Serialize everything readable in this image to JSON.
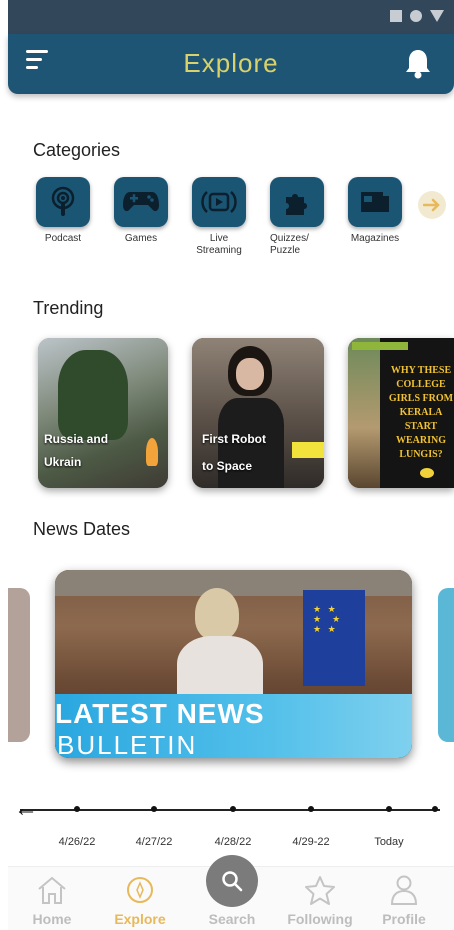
{
  "header": {
    "title": "Explore"
  },
  "colors": {
    "appbar": "#1e5575",
    "title": "#d9d26a",
    "accent": "#e8b95a",
    "category_box": "#1a5574"
  },
  "categories": {
    "title": "Categories",
    "items": [
      {
        "label": "Podcast",
        "icon": "podcast-icon"
      },
      {
        "label": "Games",
        "icon": "gamepad-icon"
      },
      {
        "label": "Live Streaming",
        "icon": "live-stream-icon"
      },
      {
        "label": "Quizzes/ Puzzle",
        "icon": "puzzle-icon"
      },
      {
        "label": "Magazines",
        "icon": "magazine-icon"
      }
    ]
  },
  "trending": {
    "title": "Trending",
    "items": [
      {
        "caption_line1": "Russia and",
        "caption_line2": "Ukrain"
      },
      {
        "caption_line1": "First Robot",
        "caption_line2": "to Space"
      },
      {
        "caption_line1": "WHY THESE COLLEGE GIRLS FROM KERALA START WEARING LUNGIS?"
      }
    ]
  },
  "news": {
    "title": "News Dates",
    "banner_line1": "LATEST NEWS",
    "banner_line2": "BULLETIN"
  },
  "timeline": {
    "dates": [
      "4/26/22",
      "4/27/22",
      "4/28/22",
      "4/29-22",
      "Today"
    ]
  },
  "nav": {
    "items": [
      {
        "label": "Home"
      },
      {
        "label": "Explore"
      },
      {
        "label": "Search"
      },
      {
        "label": "Following"
      },
      {
        "label": "Profile"
      }
    ]
  }
}
